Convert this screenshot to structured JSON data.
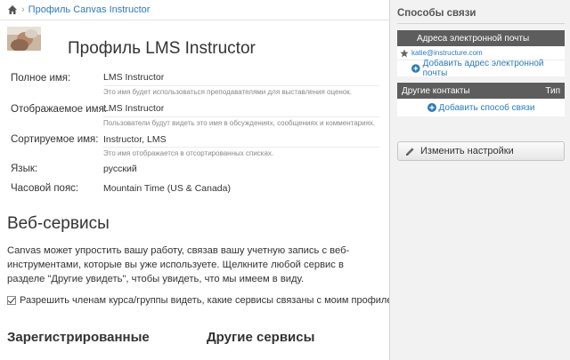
{
  "breadcrumb": {
    "current": "Профиль Canvas Instructor"
  },
  "profile": {
    "title": "Профиль LMS Instructor",
    "fields": [
      {
        "label": "Полное имя:",
        "value": "LMS Instructor",
        "hint": "Это имя будет использоваться преподавателями для выставления оценок."
      },
      {
        "label": "Отображаемое имя:",
        "value": "LMS Instructor",
        "hint": "Пользователи будут видеть это имя в обсуждениях, сообщениях и комментариях."
      },
      {
        "label": "Сортируемое имя:",
        "value": "Instructor, LMS",
        "hint": "Это имя отображается в отсортированных списках."
      },
      {
        "label": "Язык:",
        "value": "русский",
        "hint": ""
      },
      {
        "label": "Часовой пояс:",
        "value": "Mountain Time (US & Canada)",
        "hint": ""
      }
    ]
  },
  "web_services": {
    "title": "Веб-сервисы",
    "description": "Canvas может упростить вашу работу, связав вашу учетную запись с веб-инструментами, которые вы уже используете. Щелкните любой сервис в разделе \"Другие увидеть\", чтобы увидеть, что мы имеем в виду.",
    "checkbox_label": "Разрешить членам курса/группы видеть, какие сервисы связаны с моим профилем",
    "registered_title": "Зарегистрированные",
    "other_title": "Другие сервисы"
  },
  "sidebar": {
    "title": "Способы связи",
    "email_header": "Адреса электронной почты",
    "email": "katie@instructure.com",
    "add_email": "Добавить адрес электронной почты",
    "other_header": "Другие контакты",
    "type_header": "Тип",
    "add_contact": "Добавить способ связи",
    "edit_button": "Изменить настройки"
  },
  "colors": {
    "link": "#2a7abf",
    "header": "#5d5d5d",
    "sidebar_bg": "#f2f2f2"
  }
}
